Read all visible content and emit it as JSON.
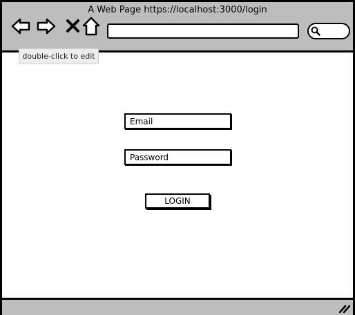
{
  "window": {
    "title": "A Web Page https://localhost:3000/login"
  },
  "toolbar": {
    "back_icon": "back-arrow-icon",
    "forward_icon": "forward-arrow-icon",
    "close_icon": "close-icon",
    "home_icon": "home-icon",
    "search_icon": "search-icon",
    "address_value": ""
  },
  "tooltip": {
    "text": "double-click to edit"
  },
  "form": {
    "email_label": "Email",
    "password_label": "Password",
    "login_label": "LOGIN"
  },
  "colors": {
    "chrome": "#bdbdbd",
    "border": "#000000",
    "page": "#ffffff"
  }
}
